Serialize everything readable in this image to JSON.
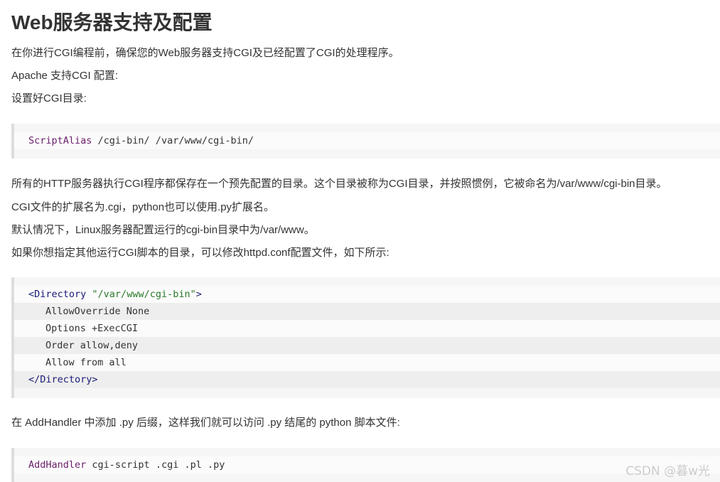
{
  "heading": "Web服务器支持及配置",
  "paragraphs": {
    "p1": "在你进行CGI编程前，确保您的Web服务器支持CGI及已经配置了CGI的处理程序。",
    "p2": "Apache 支持CGI 配置:",
    "p3": "设置好CGI目录:",
    "p4": "所有的HTTP服务器执行CGI程序都保存在一个预先配置的目录。这个目录被称为CGI目录，并按照惯例，它被命名为/var/www/cgi-bin目录。",
    "p5": "CGI文件的扩展名为.cgi，python也可以使用.py扩展名。",
    "p6": "默认情况下，Linux服务器配置运行的cgi-bin目录中为/var/www。",
    "p7": "如果你想指定其他运行CGI脚本的目录，可以修改httpd.conf配置文件，如下所示:",
    "p8": "在 AddHandler 中添加 .py 后缀，这样我们就可以访问 .py 结尾的 python 脚本文件:"
  },
  "code1": {
    "keyword": "ScriptAlias",
    "rest": " /cgi-bin/ /var/www/cgi-bin/"
  },
  "code2": {
    "open_tag": "<Directory",
    "open_string": "\"/var/www/cgi-bin\"",
    "open_close": ">",
    "line2": "AllowOverride None",
    "line3": "Options +ExecCGI",
    "line4": "Order allow,deny",
    "line5": "Allow from all",
    "close_tag": "</Directory>"
  },
  "code3": {
    "keyword": "AddHandler",
    "rest": " cgi-script .cgi .pl .py"
  },
  "watermark": "CSDN @暮w光"
}
